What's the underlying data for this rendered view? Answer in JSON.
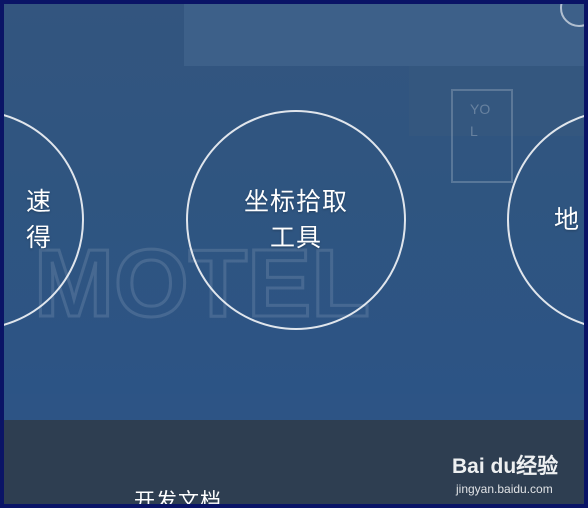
{
  "circles": {
    "left": {
      "line1": "速",
      "line2": "得"
    },
    "center": {
      "line1": "坐标拾取",
      "line2": "工具"
    },
    "right": {
      "line1": "地"
    }
  },
  "footer": {
    "link": "开发文档"
  },
  "watermark": {
    "brand": "Bai du经验",
    "url": "jingyan.baidu.com"
  },
  "colors": {
    "hero": "#2f5580",
    "footer": "#2e3e51",
    "frame": "#0a1466"
  }
}
